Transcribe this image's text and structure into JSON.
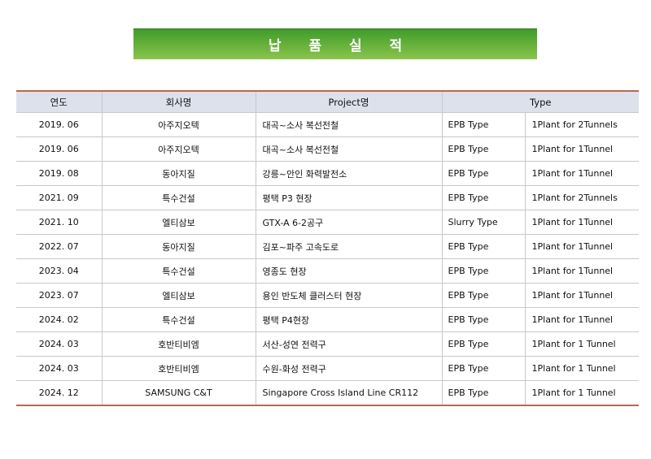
{
  "title": "납 품 실 적",
  "table": {
    "headers": [
      "연도",
      "회사명",
      "Project명",
      "Type"
    ],
    "rows": [
      {
        "year": "2019. 06",
        "company": "아주지오텍",
        "project": "대곡~소사 복선전철",
        "type1": "EPB Type",
        "type2": "1Plant  for 2Tunnels"
      },
      {
        "year": "2019. 06",
        "company": "아주지오텍",
        "project": "대곡~소사 복선전철",
        "type1": "EPB Type",
        "type2": "1Plant  for 1Tunnel"
      },
      {
        "year": "2019. 08",
        "company": "동아지질",
        "project": "강릉~안인 화력발전소",
        "type1": "EPB Type",
        "type2": "1Plant  for 1Tunnel"
      },
      {
        "year": "2021. 09",
        "company": "특수건설",
        "project": "평택 P3 현장",
        "type1": "EPB Type",
        "type2": "1Plant  for 2Tunnels"
      },
      {
        "year": "2021. 10",
        "company": "엘티삼보",
        "project": "GTX-A 6-2공구",
        "type1": "Slurry Type",
        "type2": "1Plant  for 1Tunnel"
      },
      {
        "year": "2022. 07",
        "company": "동아지질",
        "project": "김포~파주 고속도로",
        "type1": "EPB Type",
        "type2": "1Plant  for 1Tunnel"
      },
      {
        "year": "2023. 04",
        "company": "특수건설",
        "project": "영종도 현장",
        "type1": "EPB Type",
        "type2": "1Plant  for 1Tunnel"
      },
      {
        "year": "2023. 07",
        "company": "엘티삼보",
        "project": "용인 반도체 클러스터 현장",
        "type1": "EPB Type",
        "type2": "1Plant  for 1Tunnel"
      },
      {
        "year": "2024. 02",
        "company": "특수건설",
        "project": "평택 P4현장",
        "type1": "EPB Type",
        "type2": "1Plant  for 1Tunnel"
      },
      {
        "year": "2024. 03",
        "company": "호반티비엠",
        "project": "서산-성연 전력구",
        "type1": "EPB Type",
        "type2": "1Plant for 1 Tunnel"
      },
      {
        "year": "2024. 03",
        "company": "호반티비엠",
        "project": "수원-화성 전력구",
        "type1": "EPB Type",
        "type2": "1Plant for 1 Tunnel"
      },
      {
        "year": "2024. 12",
        "company": "SAMSUNG C&T",
        "project": "Singapore Cross Island Line CR112",
        "type1": "EPB Type",
        "type2": "1Plant for 1 Tunnel"
      }
    ]
  }
}
